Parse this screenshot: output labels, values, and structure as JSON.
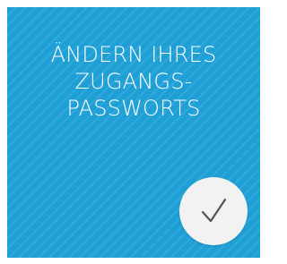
{
  "tile": {
    "title_lines": [
      "ÄNDERN IHRES",
      "ZUGANGS-",
      "PASSWORTS"
    ],
    "background_color": "#1e9fd6",
    "text_color": "#ffffff"
  },
  "action": {
    "icon": "checkmark-icon",
    "button_color": "#f2f2f2",
    "icon_color": "#555555"
  }
}
